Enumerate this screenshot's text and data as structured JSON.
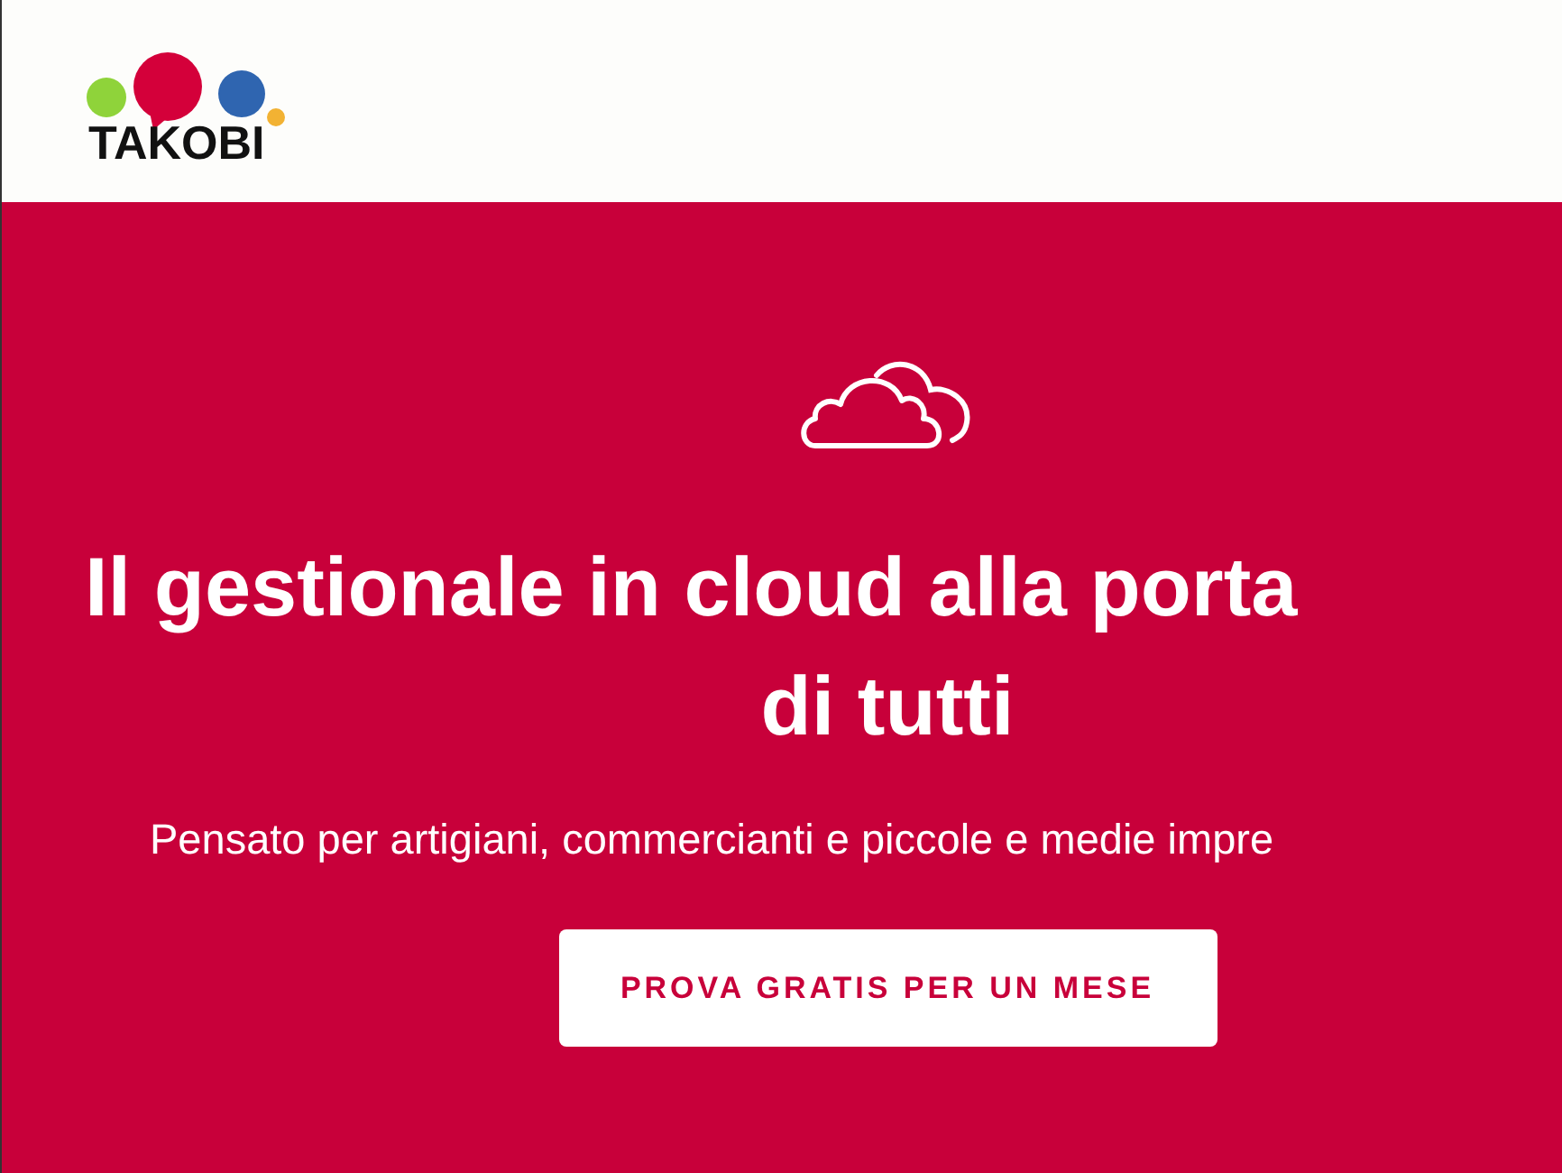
{
  "header": {
    "logo_text": "TAKOBI"
  },
  "hero": {
    "headline_lines": [
      "Il gestionale in cloud alla porta",
      "di tutti"
    ],
    "subtitle": "Pensato per artigiani, commercianti e piccole e medie impre",
    "cta_button": "PROVA GRATIS PER UN MESE"
  }
}
